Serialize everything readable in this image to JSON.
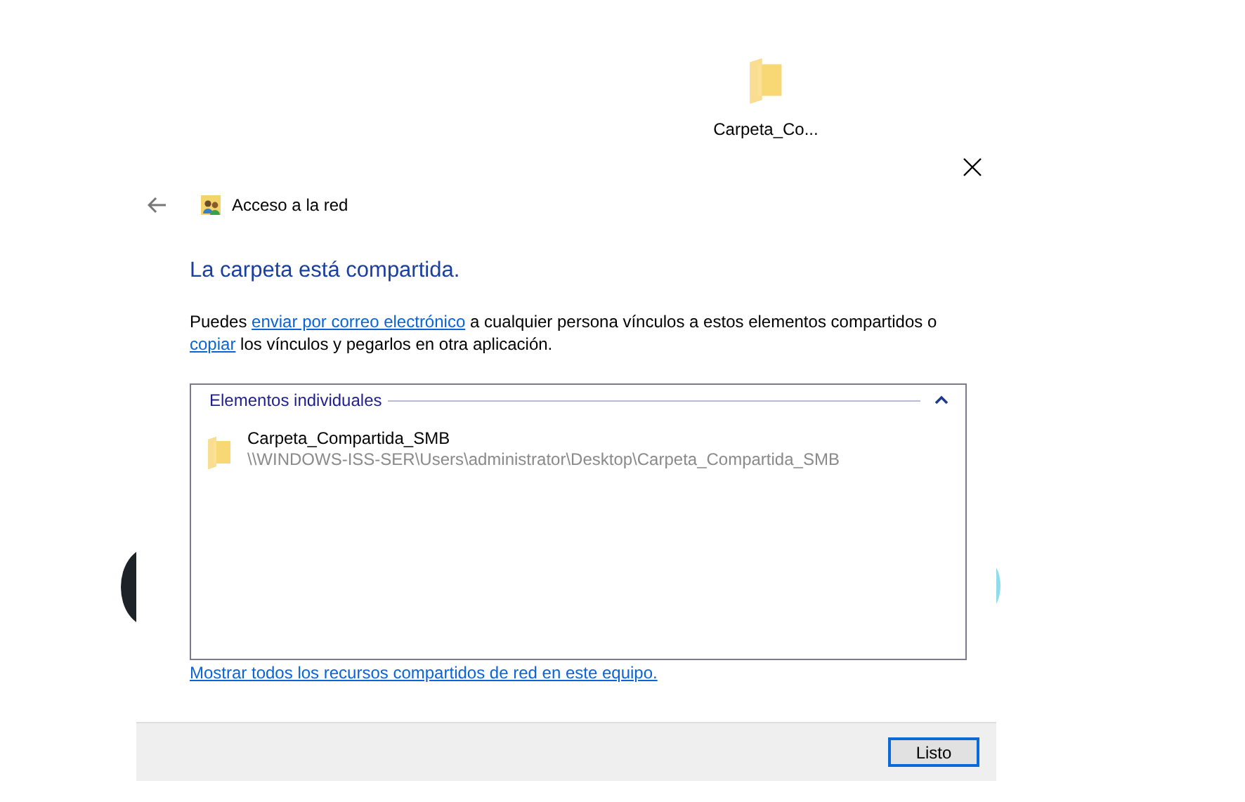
{
  "desktop_icon": {
    "label": "Carpeta_Co..."
  },
  "dialog": {
    "header": "Acceso a la red",
    "title": "La carpeta está compartida.",
    "intro": [
      {
        "kind": "text",
        "text": "Puedes "
      },
      {
        "kind": "link",
        "text": "enviar por correo electrónico"
      },
      {
        "kind": "text",
        "text": " a cualquier persona vínculos a estos elementos compartidos o"
      },
      {
        "kind": "break"
      },
      {
        "kind": "link",
        "text": "copiar"
      },
      {
        "kind": "text",
        "text": " los vínculos y pegarlos en otra aplicación."
      }
    ],
    "group": {
      "label": "Elementos individuales",
      "expanded": true,
      "items": [
        {
          "name": "Carpeta_Compartida_SMB",
          "path": "\\\\WINDOWS-ISS-SER\\Users\\administrator\\Desktop\\Carpeta_Compartida_SMB"
        }
      ]
    },
    "show_all_link": "Mostrar todos los recursos compartidos de red en este equipo.",
    "buttons": [
      "Listo"
    ]
  }
}
